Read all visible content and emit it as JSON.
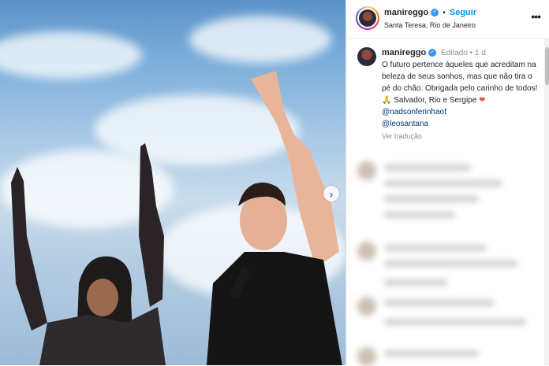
{
  "post": {
    "username": "manireggo",
    "follow_label": "Seguir",
    "location": "Santa Teresa, Rio de Janeiro",
    "caption": {
      "username": "manireggo",
      "edited_label": "Editado",
      "age": "1 d",
      "text": "O futuro pertence àqueles que acreditam na beleza de seus sonhos, mas que não tira o pé do chão. Obrigada pelo carinho de todos! 🙏 Salvador, Rio e Sergipe",
      "mention_1": "@nadsonferinhaof",
      "mention_2": "@leosantana",
      "translate_label": "Ver tradução"
    }
  },
  "icons": {
    "verified": "verified-badge-icon",
    "more": "more-options-icon",
    "next": "carousel-next-icon",
    "heart": "heart-emoji"
  },
  "colors": {
    "follow": "#0095f6",
    "mention": "#00376b",
    "verified": "#3897f0",
    "heart": "#ed4956"
  }
}
